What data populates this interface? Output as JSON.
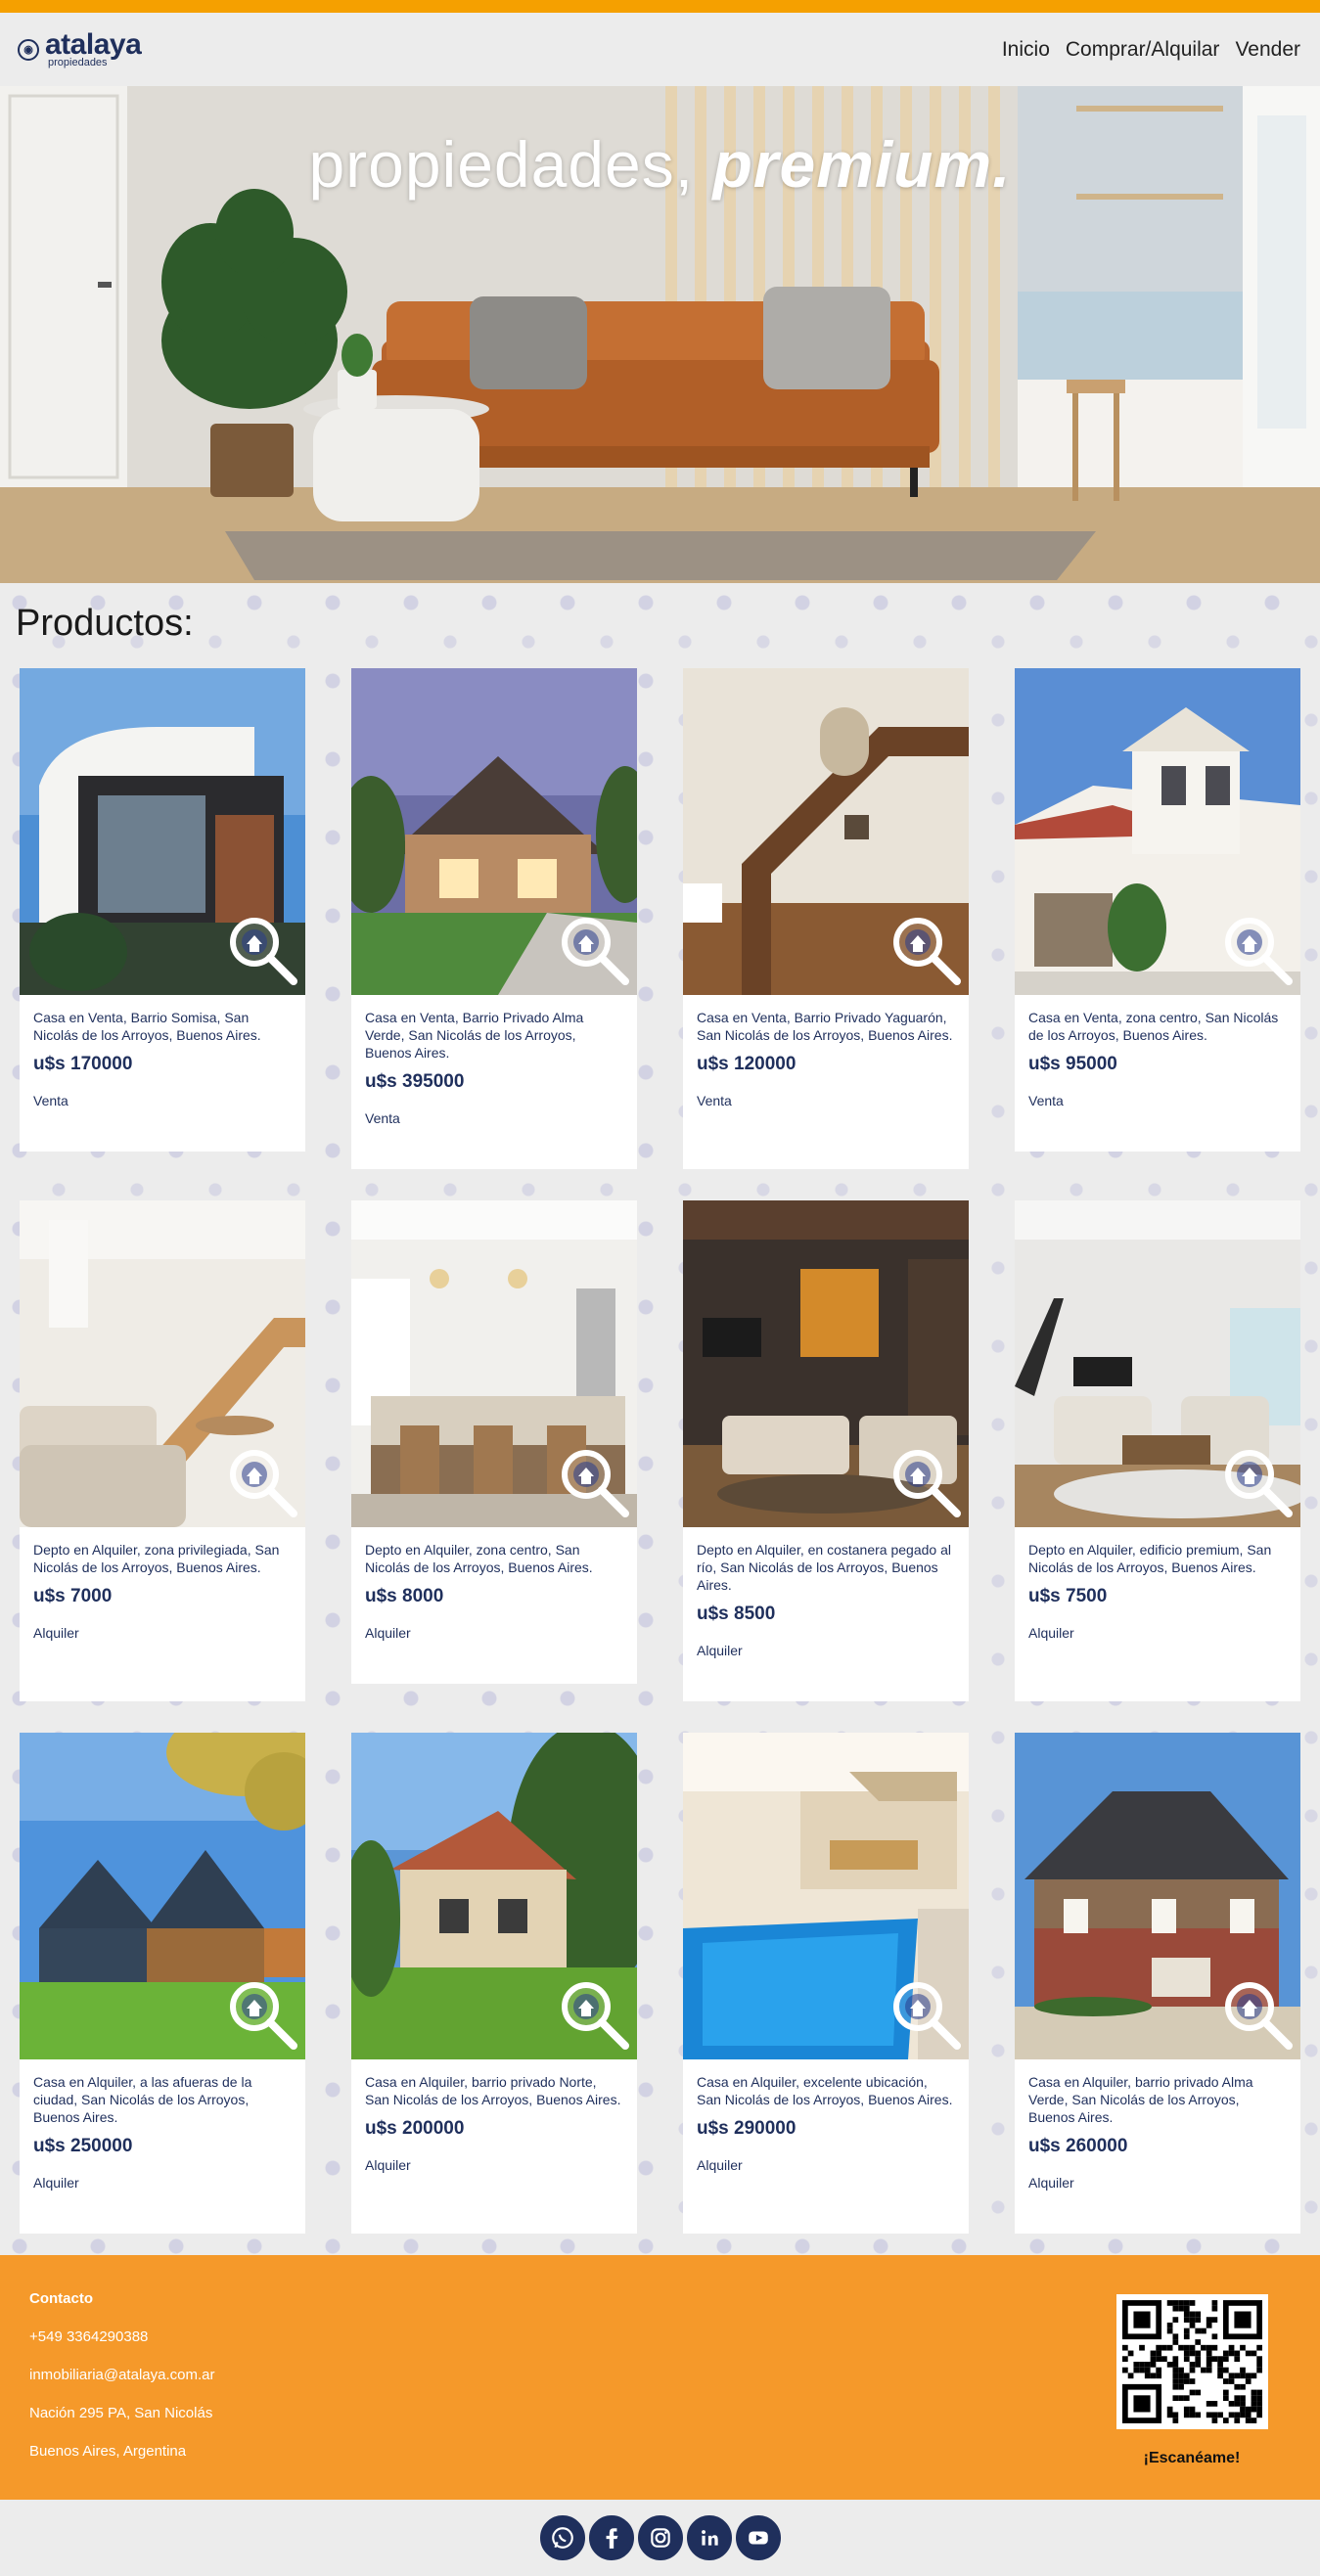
{
  "header": {
    "logo_name": "atalaya",
    "logo_sub": "propiedades",
    "nav": [
      "Inicio",
      "Comprar/Alquilar",
      "Vender"
    ]
  },
  "hero": {
    "title_light": "propiedades,",
    "title_bold": "premium."
  },
  "products": {
    "title": "Productos:",
    "items": [
      {
        "desc": "Casa en Venta, Barrio Somisa, San Nicolás de los Arroyos, Buenos Aires.",
        "price": "u$s 170000",
        "type": "Venta",
        "scene": "modern-house"
      },
      {
        "desc": "Casa en Venta, Barrio Privado Alma Verde, San Nicolás de los Arroyos, Buenos Aires.",
        "price": "u$s 395000",
        "type": "Venta",
        "scene": "stone-house"
      },
      {
        "desc": "Casa en Venta, Barrio Privado Yaguarón, San Nicolás de los Arroyos, Buenos Aires.",
        "price": "u$s 120000",
        "type": "Venta",
        "scene": "staircase"
      },
      {
        "desc": "Casa en Venta, zona centro, San Nicolás de los Arroyos, Buenos Aires.",
        "price": "u$s 95000",
        "type": "Venta",
        "scene": "white-villa"
      },
      {
        "desc": "Depto en Alquiler, zona privilegiada, San Nicolás de los Arroyos, Buenos Aires.",
        "price": "u$s 7000",
        "type": "Alquiler",
        "scene": "bright-living"
      },
      {
        "desc": "Depto en Alquiler, zona centro, San Nicolás de los Arroyos, Buenos Aires.",
        "price": "u$s 8000",
        "type": "Alquiler",
        "scene": "kitchen"
      },
      {
        "desc": "Depto en Alquiler, en costanera pegado al río, San Nicolás de los Arroyos, Buenos Aires.",
        "price": "u$s 8500",
        "type": "Alquiler",
        "scene": "dark-living"
      },
      {
        "desc": "Depto en Alquiler, edificio premium, San Nicolás de los Arroyos, Buenos Aires.",
        "price": "u$s 7500",
        "type": "Alquiler",
        "scene": "grey-living"
      },
      {
        "desc": "Casa en Alquiler, a las afueras de la ciudad, San Nicolás de los Arroyos, Buenos Aires.",
        "price": "u$s 250000",
        "type": "Alquiler",
        "scene": "barn-house"
      },
      {
        "desc": "Casa en Alquiler, barrio privado Norte, San Nicolás de los Arroyos, Buenos Aires.",
        "price": "u$s 200000",
        "type": "Alquiler",
        "scene": "forest-house"
      },
      {
        "desc": "Casa en Alquiler, excelente ubicación, San Nicolás de los Arroyos, Buenos Aires.",
        "price": "u$s 290000",
        "type": "Alquiler",
        "scene": "pool"
      },
      {
        "desc": "Casa en Alquiler, barrio privado Alma Verde, San Nicolás de los Arroyos, Buenos Aires.",
        "price": "u$s 260000",
        "type": "Alquiler",
        "scene": "brick-house"
      }
    ]
  },
  "footer": {
    "contact_title": "Contacto",
    "lines": [
      "+549 3364290388",
      "inmobiliaria@atalaya.com.ar",
      "Nación 295 PA, San Nicolás",
      "Buenos Aires, Argentina"
    ],
    "qr_label": "¡Escanéame!"
  },
  "social": [
    "whatsapp-icon",
    "facebook-icon",
    "instagram-icon",
    "linkedin-icon",
    "youtube-icon"
  ],
  "colors": {
    "accent": "#f5a000",
    "footer": "#f5992a",
    "brand_navy": "#1f2f5c"
  }
}
